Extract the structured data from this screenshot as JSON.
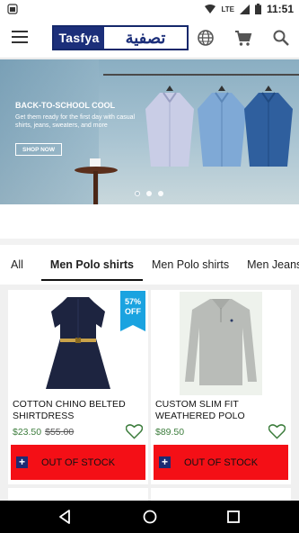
{
  "status_bar": {
    "network": "LTE",
    "time": "11:51"
  },
  "header": {
    "logo_en": "Tasfya",
    "logo_ar": "تصفية",
    "icons": [
      "menu-icon",
      "globe-icon",
      "cart-icon",
      "search-icon"
    ]
  },
  "banner": {
    "headline": "BACK-TO-SCHOOL COOL",
    "body": "Get them ready for the first day with casual shirts, jeans, sweaters, and more",
    "cta": "SHOP NOW",
    "carousel_index": 1,
    "carousel_count": 3
  },
  "tabs": [
    {
      "label": "All",
      "active": false
    },
    {
      "label": "Men Polo shirts",
      "active": true
    },
    {
      "label": "Men Polo shirts",
      "active": false
    },
    {
      "label": "Men Jeans",
      "active": false
    }
  ],
  "products": [
    {
      "title": "COTTON CHINO BELTED SHIRTDRESS",
      "price": "$23.50",
      "old_price": "$55.00",
      "discount": "57% OFF",
      "discount_lines": [
        "57%",
        "OFF"
      ],
      "button": "OUT OF STOCK",
      "button_icon": "+"
    },
    {
      "title": "CUSTOM SLIM FIT WEATHERED POLO",
      "price": "$89.50",
      "old_price": "",
      "button": "OUT OF STOCK",
      "button_icon": "+"
    }
  ],
  "colors": {
    "brand_navy": "#1c2f7a",
    "discount_blue": "#1aa3e0",
    "out_of_stock_red": "#f40f16",
    "price_green": "#3d7d3d",
    "heart_green": "#3d7d3d"
  }
}
